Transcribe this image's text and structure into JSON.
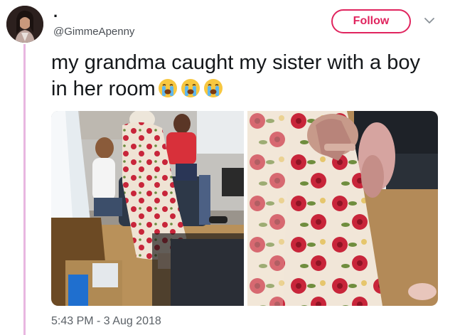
{
  "tweet": {
    "display_name": ".",
    "handle": "@GimmeApenny",
    "follow_label": "Follow",
    "text": "my grandma caught my sister with a boy in her room",
    "emojis": [
      "loudly-crying-face",
      "loudly-crying-face",
      "loudly-crying-face"
    ],
    "timestamp": "5:43 PM - 3 Aug 2018"
  },
  "icons": {
    "menu": "chevron-down-icon"
  },
  "colors": {
    "follow_accent": "#e0245e",
    "thread_line": "#e8b6e0",
    "dress_floral": "#c8253a"
  }
}
